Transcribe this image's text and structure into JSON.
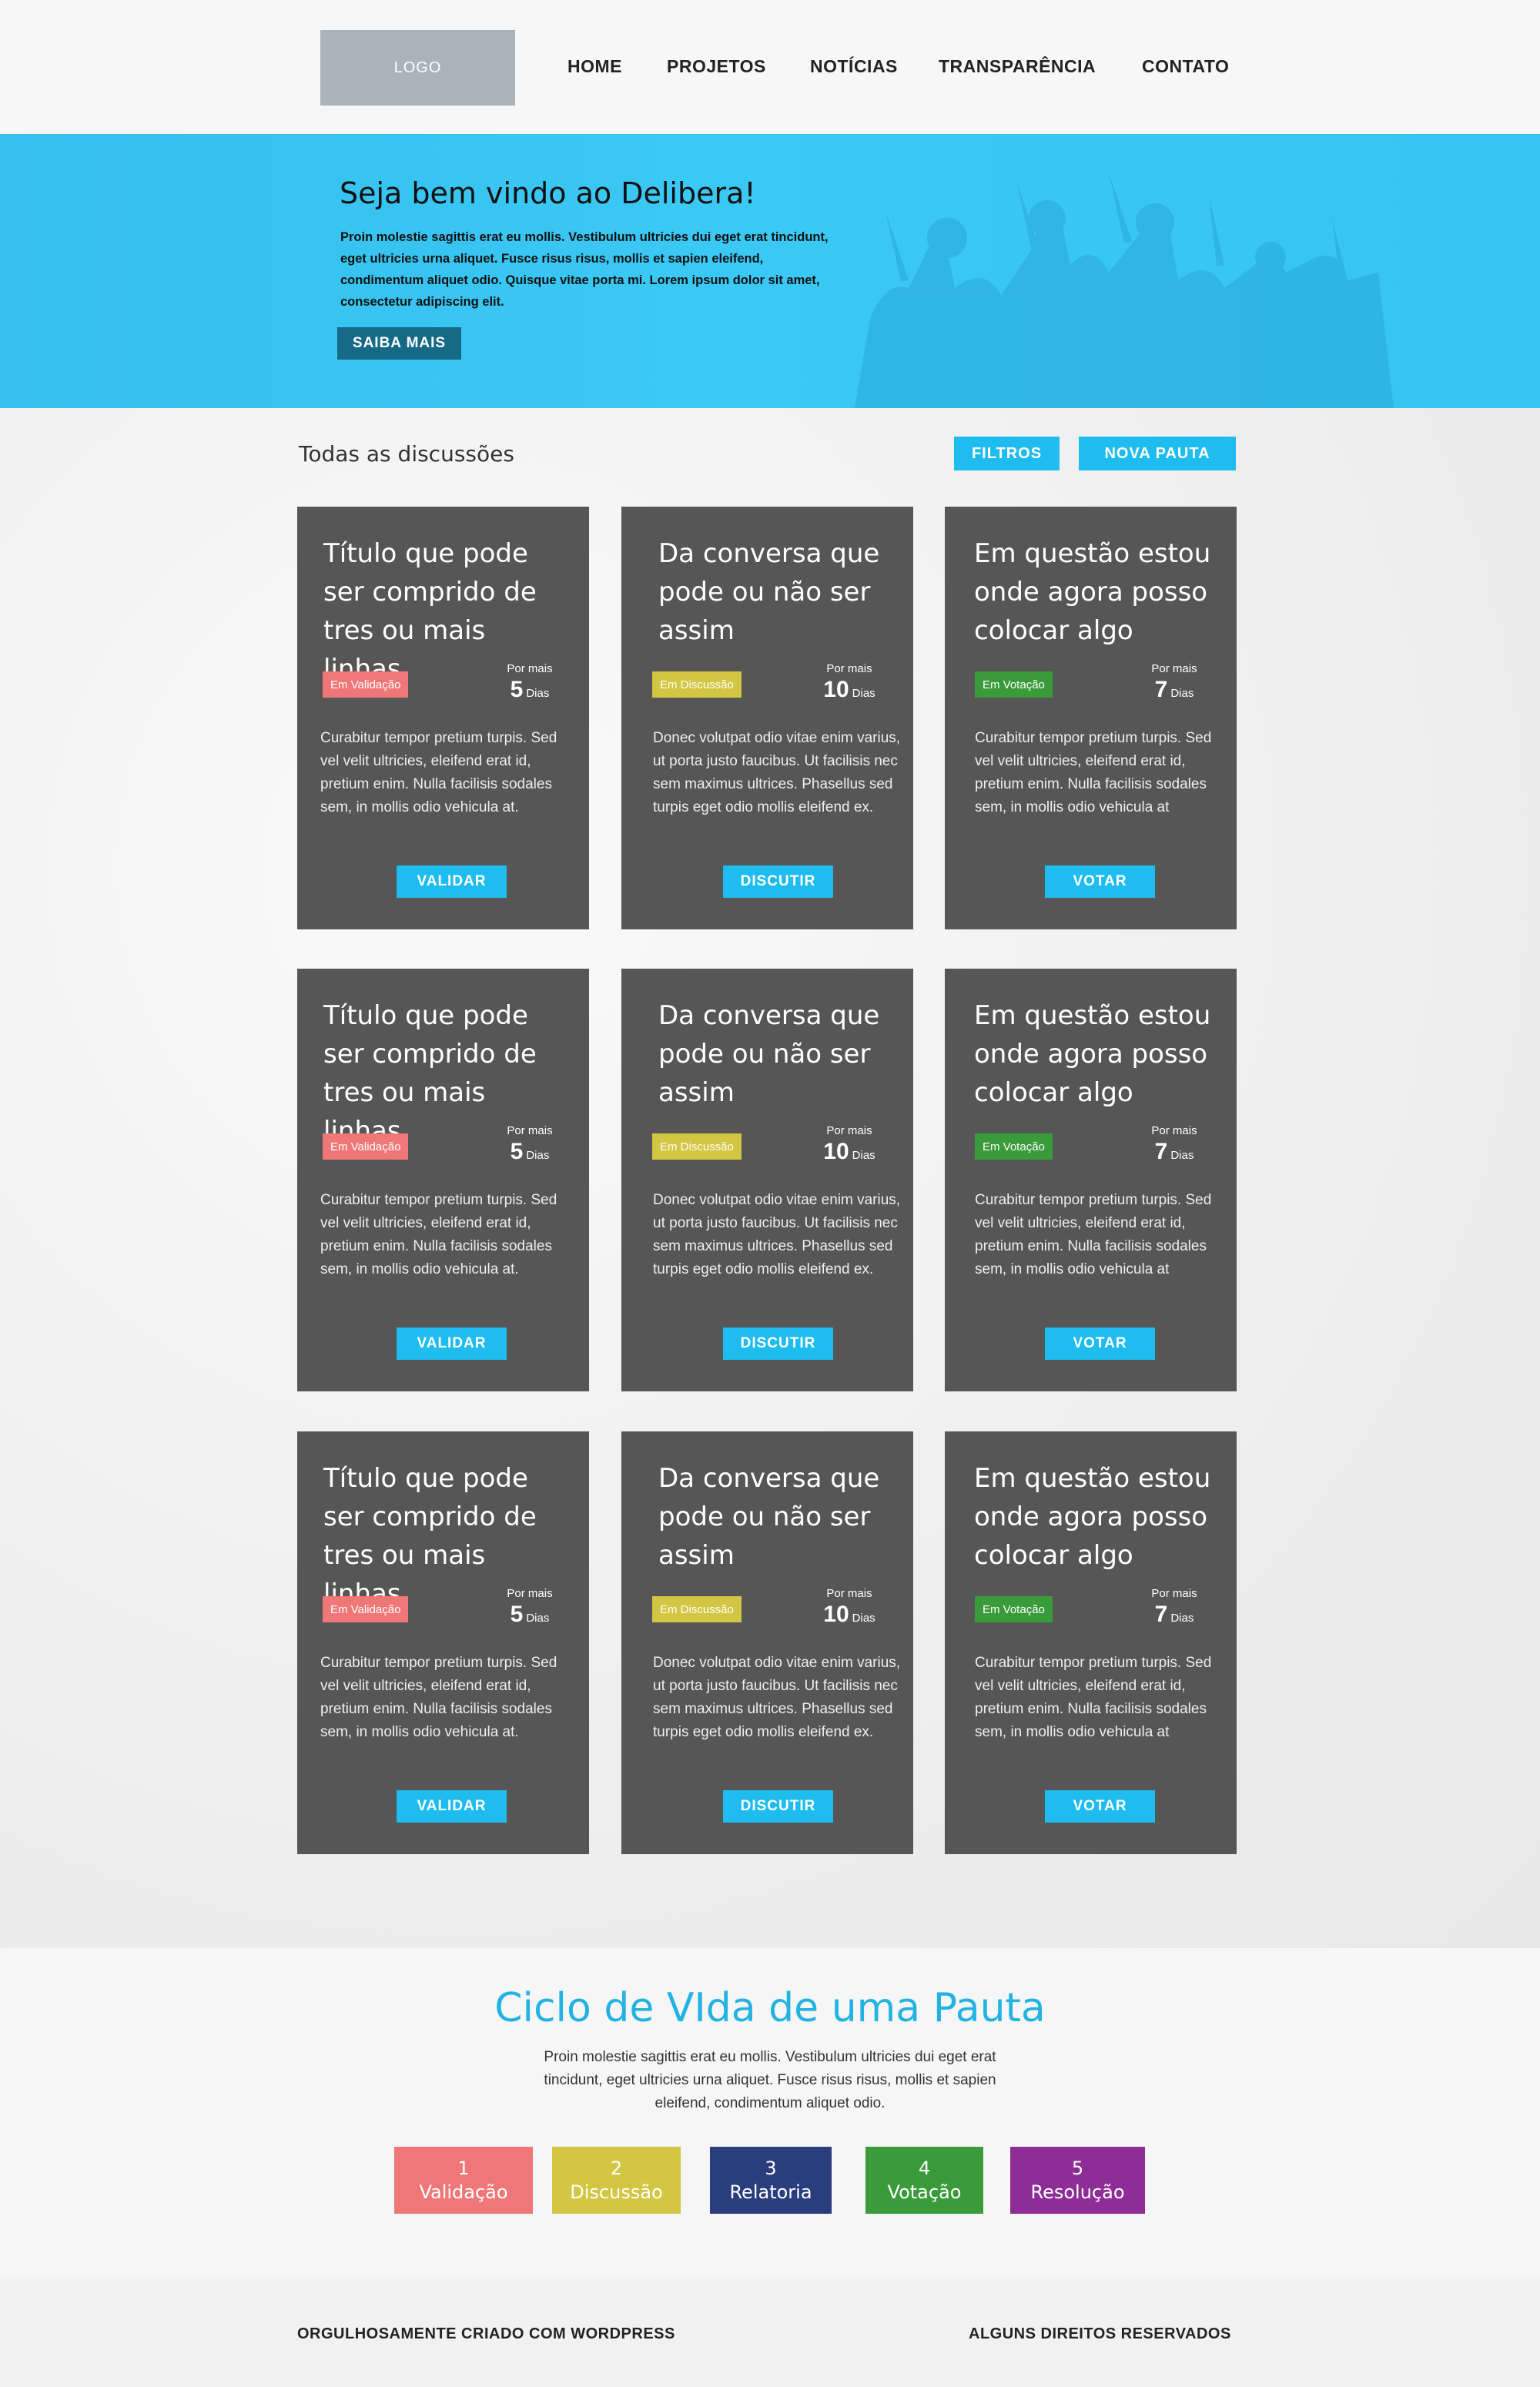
{
  "header": {
    "logo": "LOGO",
    "nav": [
      "HOME",
      "PROJETOS",
      "NOTÍCIAS",
      "TRANSPARÊNCIA",
      "CONTATO"
    ]
  },
  "hero": {
    "title": "Seja bem vindo ao Delibera!",
    "text": "Proin molestie sagittis erat eu mollis. Vestibulum ultricies dui eget erat tincidunt, eget ultricies urna aliquet. Fusce risus risus, mollis et sapien eleifend, condimentum aliquet odio. Quisque vitae porta mi. Lorem ipsum dolor sit amet, consectetur adipiscing elit.",
    "button": "SAIBA MAIS"
  },
  "discussions": {
    "title": "Todas as discussões",
    "filters_button": "FILTROS",
    "new_button": "NOVA PAUTA",
    "cards": [
      {
        "title": "Título que pode ser comprido de tres ou mais linhas",
        "status": "Em Validação",
        "status_color": "#f07777",
        "days_label": "Por mais",
        "days": "5",
        "days_unit": "Dias",
        "text": "Curabitur tempor pretium turpis. Sed vel velit ultricies, eleifend erat id, pretium enim. Nulla facilisis sodales sem, in mollis odio vehicula at.",
        "button": "VALIDAR"
      },
      {
        "title": "Da conversa que pode ou não ser assim",
        "status": "Em Discussão",
        "status_color": "#d3c642",
        "days_label": "Por mais",
        "days": "10",
        "days_unit": "Dias",
        "text": "Donec volutpat odio vitae enim varius, ut porta justo faucibus. Ut facilisis nec sem maximus ultrices. Phasellus sed turpis eget odio mollis eleifend ex.",
        "button": "DISCUTIR"
      },
      {
        "title": "Em questão estou onde agora posso colocar algo",
        "status": "Em Votação",
        "status_color": "#3a9b3a",
        "days_label": "Por mais",
        "days": "7",
        "days_unit": "Dias",
        "text": "Curabitur tempor pretium turpis. Sed vel velit ultricies, eleifend erat id, pretium enim. Nulla facilisis sodales sem, in mollis odio vehicula at",
        "button": "VOTAR"
      },
      {
        "title": "Título que pode ser comprido de tres ou mais linhas",
        "status": "Em Validação",
        "status_color": "#f07777",
        "days_label": "Por mais",
        "days": "5",
        "days_unit": "Dias",
        "text": "Curabitur tempor pretium turpis. Sed vel velit ultricies, eleifend erat id, pretium enim. Nulla facilisis sodales sem, in mollis odio vehicula at.",
        "button": "VALIDAR"
      },
      {
        "title": "Da conversa que pode ou não ser assim",
        "status": "Em Discussão",
        "status_color": "#d3c642",
        "days_label": "Por mais",
        "days": "10",
        "days_unit": "Dias",
        "text": "Donec volutpat odio vitae enim varius, ut porta justo faucibus. Ut facilisis nec sem maximus ultrices. Phasellus sed turpis eget odio mollis eleifend ex.",
        "button": "DISCUTIR"
      },
      {
        "title": "Em questão estou onde agora posso colocar algo",
        "status": "Em Votação",
        "status_color": "#3a9b3a",
        "days_label": "Por mais",
        "days": "7",
        "days_unit": "Dias",
        "text": "Curabitur tempor pretium turpis. Sed vel velit ultricies, eleifend erat id, pretium enim. Nulla facilisis sodales sem, in mollis odio vehicula at",
        "button": "VOTAR"
      },
      {
        "title": "Título que pode ser comprido de tres ou mais linhas",
        "status": "Em Validação",
        "status_color": "#f07777",
        "days_label": "Por mais",
        "days": "5",
        "days_unit": "Dias",
        "text": "Curabitur tempor pretium turpis. Sed vel velit ultricies, eleifend erat id, pretium enim. Nulla facilisis sodales sem, in mollis odio vehicula at.",
        "button": "VALIDAR"
      },
      {
        "title": "Da conversa que pode ou não ser assim",
        "status": "Em Discussão",
        "status_color": "#d3c642",
        "days_label": "Por mais",
        "days": "10",
        "days_unit": "Dias",
        "text": "Donec volutpat odio vitae enim varius, ut porta justo faucibus. Ut facilisis nec sem maximus ultrices. Phasellus sed turpis eget odio mollis eleifend ex.",
        "button": "DISCUTIR"
      },
      {
        "title": "Em questão estou onde agora posso colocar algo",
        "status": "Em Votação",
        "status_color": "#3a9b3a",
        "days_label": "Por mais",
        "days": "7",
        "days_unit": "Dias",
        "text": "Curabitur tempor pretium turpis. Sed vel velit ultricies, eleifend erat id, pretium enim. Nulla facilisis sodales sem, in mollis odio vehicula at",
        "button": "VOTAR"
      }
    ]
  },
  "ciclo": {
    "title": "Ciclo de VIda de uma Pauta",
    "text": "Proin molestie sagittis erat eu mollis. Vestibulum ultricies dui eget erat tincidunt, eget ultricies urna aliquet. Fusce risus risus, mollis et sapien eleifend, condimentum aliquet odio.",
    "stages": [
      {
        "number": "1",
        "label": "Validação",
        "color": "#f07777"
      },
      {
        "number": "2",
        "label": "Discussão",
        "color": "#d3c642"
      },
      {
        "number": "3",
        "label": "Relatoria",
        "color": "#2a3d7d"
      },
      {
        "number": "4",
        "label": "Votação",
        "color": "#3a9b3a"
      },
      {
        "number": "5",
        "label": "Resolução",
        "color": "#8e2d97"
      }
    ]
  },
  "footer": {
    "left": "ORGULHOSAMENTE CRIADO COM WORDPRESS",
    "right": "ALGUNS DIREITOS RESERVADOS"
  },
  "colors": {
    "accent": "#1fbdef",
    "hero_bg": "#3ac8f4",
    "card_bg": "#565657",
    "hero_button": "#166a86"
  }
}
